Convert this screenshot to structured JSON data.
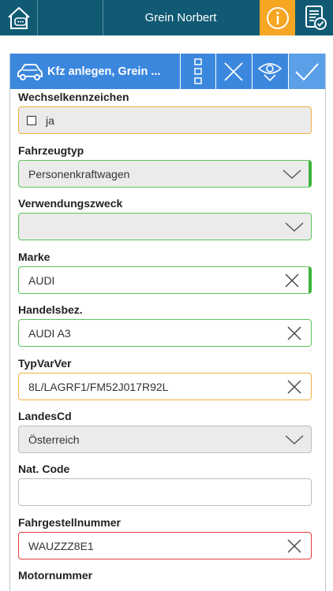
{
  "topbar": {
    "user_name": "Grein Norbert",
    "icons": {
      "home": "home-chat-icon",
      "info": "info-icon",
      "docs": "document-check-icon"
    },
    "colors": {
      "bar": "#105a74",
      "info_bg": "#f6a623"
    }
  },
  "card": {
    "title": "Kfz anlegen, Grein ...",
    "header_color": "#3b87de",
    "icons": {
      "car": "car-icon",
      "menu": "vertical-dots-icon",
      "close": "close-icon",
      "preview": "eye-icon",
      "confirm": "checkmark-icon"
    }
  },
  "form": {
    "wechselkennzeichen": {
      "label": "Wechselkennzeichen",
      "value": "ja",
      "checked": false
    },
    "fahrzeugtyp": {
      "label": "Fahrzeugtyp",
      "value": "Personenkraftwagen"
    },
    "verwendungszweck": {
      "label": "Verwendungszweck",
      "value": ""
    },
    "marke": {
      "label": "Marke",
      "value": "AUDI"
    },
    "handelsbez": {
      "label": "Handelsbez.",
      "value": "AUDI A3"
    },
    "typvarver": {
      "label": "TypVarVer",
      "value": "8L/LAGRF1/FM52J017R92L"
    },
    "landescd": {
      "label": "LandesCd",
      "value": "Österreich"
    },
    "natcode": {
      "label": "Nat. Code",
      "value": ""
    },
    "fahrgestellnummer": {
      "label": "Fahrgestellnummer",
      "value": "WAUZZZ8E1"
    },
    "motornummer": {
      "label": "Motornummer"
    }
  }
}
